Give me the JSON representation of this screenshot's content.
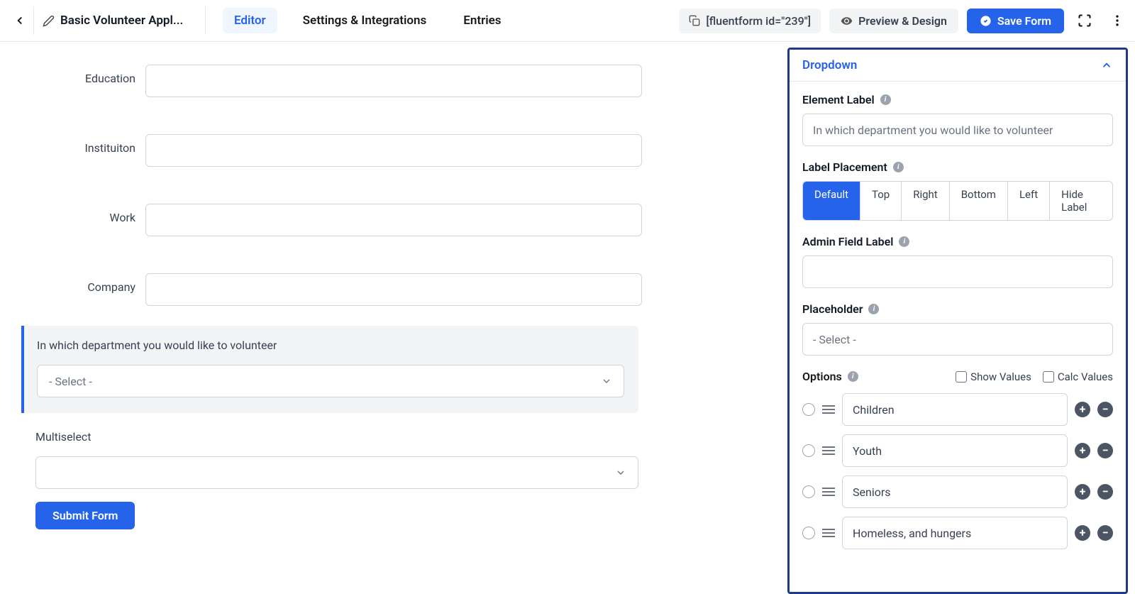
{
  "header": {
    "title": "Basic Volunteer Appl...",
    "shortcode": "[fluentform id=\"239\"]",
    "preview_label": "Preview & Design",
    "save_label": "Save Form"
  },
  "tabs": {
    "editor": "Editor",
    "settings": "Settings & Integrations",
    "entries": "Entries"
  },
  "form_fields": {
    "education": "Education",
    "institution": "Instituiton",
    "work": "Work",
    "company": "Company"
  },
  "dropdown_block": {
    "label": "In which department you would like to volunteer",
    "placeholder": "- Select -"
  },
  "multiselect": {
    "label": "Multiselect"
  },
  "submit_label": "Submit Form",
  "side_panel": {
    "title": "Dropdown",
    "element_label": {
      "label": "Element Label",
      "value": "In which department you would like to volunteer"
    },
    "label_placement": {
      "label": "Label Placement",
      "options": [
        "Default",
        "Top",
        "Right",
        "Bottom",
        "Left",
        "Hide Label"
      ]
    },
    "admin_field_label": {
      "label": "Admin Field Label",
      "value": ""
    },
    "placeholder_setting": {
      "label": "Placeholder",
      "value": "- Select -"
    },
    "options_section": {
      "label": "Options",
      "show_values_label": "Show Values",
      "calc_values_label": "Calc Values",
      "items": [
        "Children",
        "Youth",
        "Seniors",
        "Homeless, and hungers"
      ]
    }
  }
}
